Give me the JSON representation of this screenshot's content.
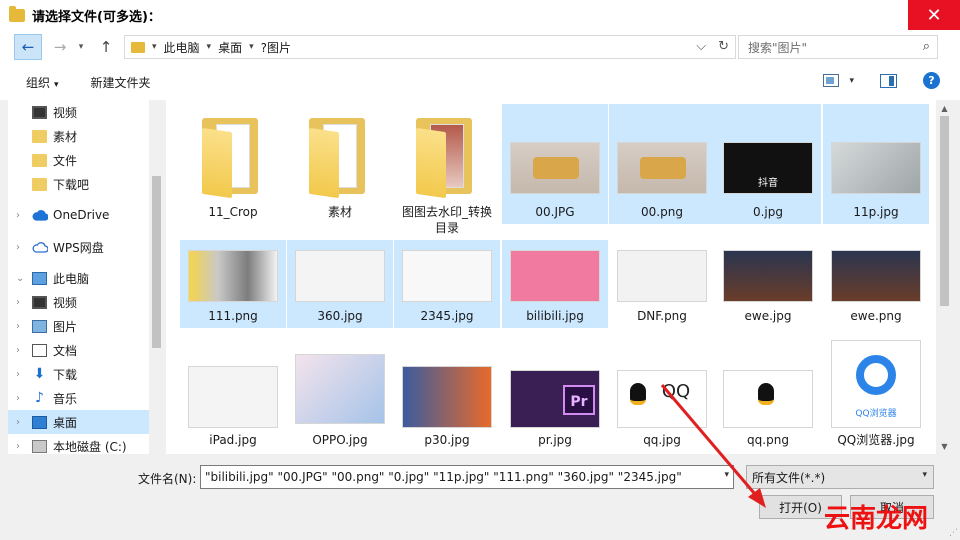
{
  "window": {
    "title": "请选择文件(可多选)：",
    "close_glyph": "✕"
  },
  "address": {
    "back_glyph": "←",
    "forward_glyph": "→",
    "up_glyph": "↑",
    "dropdown_glyph": "▾",
    "crumbs": [
      "此电脑",
      "桌面",
      "?图片"
    ],
    "separator": "▸",
    "dropdown": "⌵",
    "refresh": "↻"
  },
  "search": {
    "placeholder": "搜索\"图片\"",
    "icon": "⌕"
  },
  "toolbar": {
    "organize": "组织",
    "organize_caret": "▾",
    "new_folder": "新建文件夹",
    "view_caret": "▾",
    "help": "?"
  },
  "nav": {
    "items": [
      {
        "label": "视频",
        "icon": "video-icon",
        "expander": ""
      },
      {
        "label": "素材",
        "icon": "folder-icon",
        "expander": ""
      },
      {
        "label": "文件",
        "icon": "folder-icon",
        "expander": ""
      },
      {
        "label": "下载吧",
        "icon": "folder-icon",
        "expander": ""
      },
      {
        "label": "OneDrive",
        "icon": "onedrive-icon",
        "expander": "›"
      },
      {
        "label": "WPS网盘",
        "icon": "wps-cloud-icon",
        "expander": "›"
      },
      {
        "label": "此电脑",
        "icon": "computer-icon",
        "expander": "⌄"
      },
      {
        "label": "视频",
        "icon": "video-icon",
        "expander": "›"
      },
      {
        "label": "图片",
        "icon": "pictures-icon",
        "expander": "›"
      },
      {
        "label": "文档",
        "icon": "documents-icon",
        "expander": "›"
      },
      {
        "label": "下载",
        "icon": "download-icon",
        "expander": "›"
      },
      {
        "label": "音乐",
        "icon": "music-icon",
        "expander": "›"
      },
      {
        "label": "桌面",
        "icon": "desktop-icon",
        "expander": "›",
        "selected": true
      },
      {
        "label": "本地磁盘 (C:)",
        "icon": "disk-icon",
        "expander": "›"
      }
    ]
  },
  "files": [
    {
      "name": "11_Crop",
      "kind": "folder",
      "selected": false
    },
    {
      "name": "素材",
      "kind": "folder",
      "selected": false
    },
    {
      "name": "图图去水印_转换目录",
      "kind": "folder",
      "selected": false
    },
    {
      "name": "00.JPG",
      "kind": "image",
      "selected": true
    },
    {
      "name": "00.png",
      "kind": "image",
      "selected": true
    },
    {
      "name": "0.jpg",
      "kind": "image",
      "selected": true,
      "caption": "抖音"
    },
    {
      "name": "11p.jpg",
      "kind": "image",
      "selected": true
    },
    {
      "name": "111.png",
      "kind": "image",
      "selected": true
    },
    {
      "name": "360.jpg",
      "kind": "image",
      "selected": true
    },
    {
      "name": "2345.jpg",
      "kind": "image",
      "selected": true
    },
    {
      "name": "bilibili.jpg",
      "kind": "image",
      "selected": true
    },
    {
      "name": "DNF.png",
      "kind": "image",
      "selected": false
    },
    {
      "name": "ewe.jpg",
      "kind": "image",
      "selected": false
    },
    {
      "name": "ewe.png",
      "kind": "image",
      "selected": false
    },
    {
      "name": "iPad.jpg",
      "kind": "image",
      "selected": false
    },
    {
      "name": "OPPO.jpg",
      "kind": "image",
      "selected": false
    },
    {
      "name": "p30.jpg",
      "kind": "image",
      "selected": false
    },
    {
      "name": "pr.jpg",
      "kind": "image",
      "selected": false,
      "caption": "Pr"
    },
    {
      "name": "qq.jpg",
      "kind": "image",
      "selected": false,
      "caption": "QQ"
    },
    {
      "name": "qq.png",
      "kind": "image",
      "selected": false
    },
    {
      "name": "QQ浏览器.jpg",
      "kind": "image",
      "selected": false,
      "caption": "QQ浏览器"
    }
  ],
  "footer": {
    "filename_label": "文件名(N):",
    "filename_value": "\"bilibili.jpg\" \"00.JPG\" \"00.png\" \"0.jpg\" \"11p.jpg\" \"111.png\" \"360.jpg\" \"2345.jpg\"",
    "filetype_value": "所有文件(*.*)",
    "dropdown_glyph": "▾",
    "open_label": "打开(O)",
    "cancel_label": "取消",
    "watermark": "云南龙网",
    "grip": "⋰"
  },
  "colors": {
    "accent": "#1a73d0",
    "selection": "#cce8ff",
    "close": "#e81123",
    "arrow": "#e02020"
  }
}
